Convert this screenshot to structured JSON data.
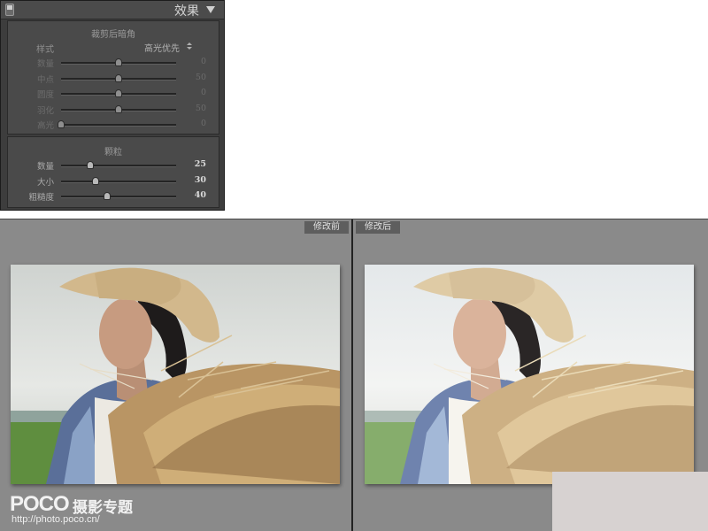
{
  "panel": {
    "title": "效果",
    "vignette": {
      "title": "裁剪后暗角",
      "style_label": "样式",
      "style_value": "高光优先",
      "sliders": [
        {
          "label": "数量",
          "value": "0",
          "position": 0.5
        },
        {
          "label": "中点",
          "value": "50",
          "position": 0.5
        },
        {
          "label": "圆度",
          "value": "0",
          "position": 0.5
        },
        {
          "label": "羽化",
          "value": "50",
          "position": 0.5
        },
        {
          "label": "高光",
          "value": "0",
          "position": 0.0
        }
      ]
    },
    "grain": {
      "title": "颗粒",
      "sliders": [
        {
          "label": "数量",
          "value": "25",
          "position": 0.25
        },
        {
          "label": "大小",
          "value": "30",
          "position": 0.3
        },
        {
          "label": "粗糙度",
          "value": "40",
          "position": 0.4
        }
      ]
    }
  },
  "compare": {
    "before_label": "修改前",
    "after_label": "修改后"
  },
  "watermark": {
    "logo": "POCO",
    "text": "摄影专题",
    "url": "http://photo.poco.cn/"
  },
  "icons": {
    "panel_toggle": "switch-icon",
    "collapse": "triangle-down-icon",
    "stepper": "up-down-arrows-icon"
  },
  "colors": {
    "panel_bg": "#3d3d3d",
    "section_bg": "#4a4a4a",
    "compare_bg": "#8a8a8a",
    "label_bg": "#5e5e5e"
  }
}
